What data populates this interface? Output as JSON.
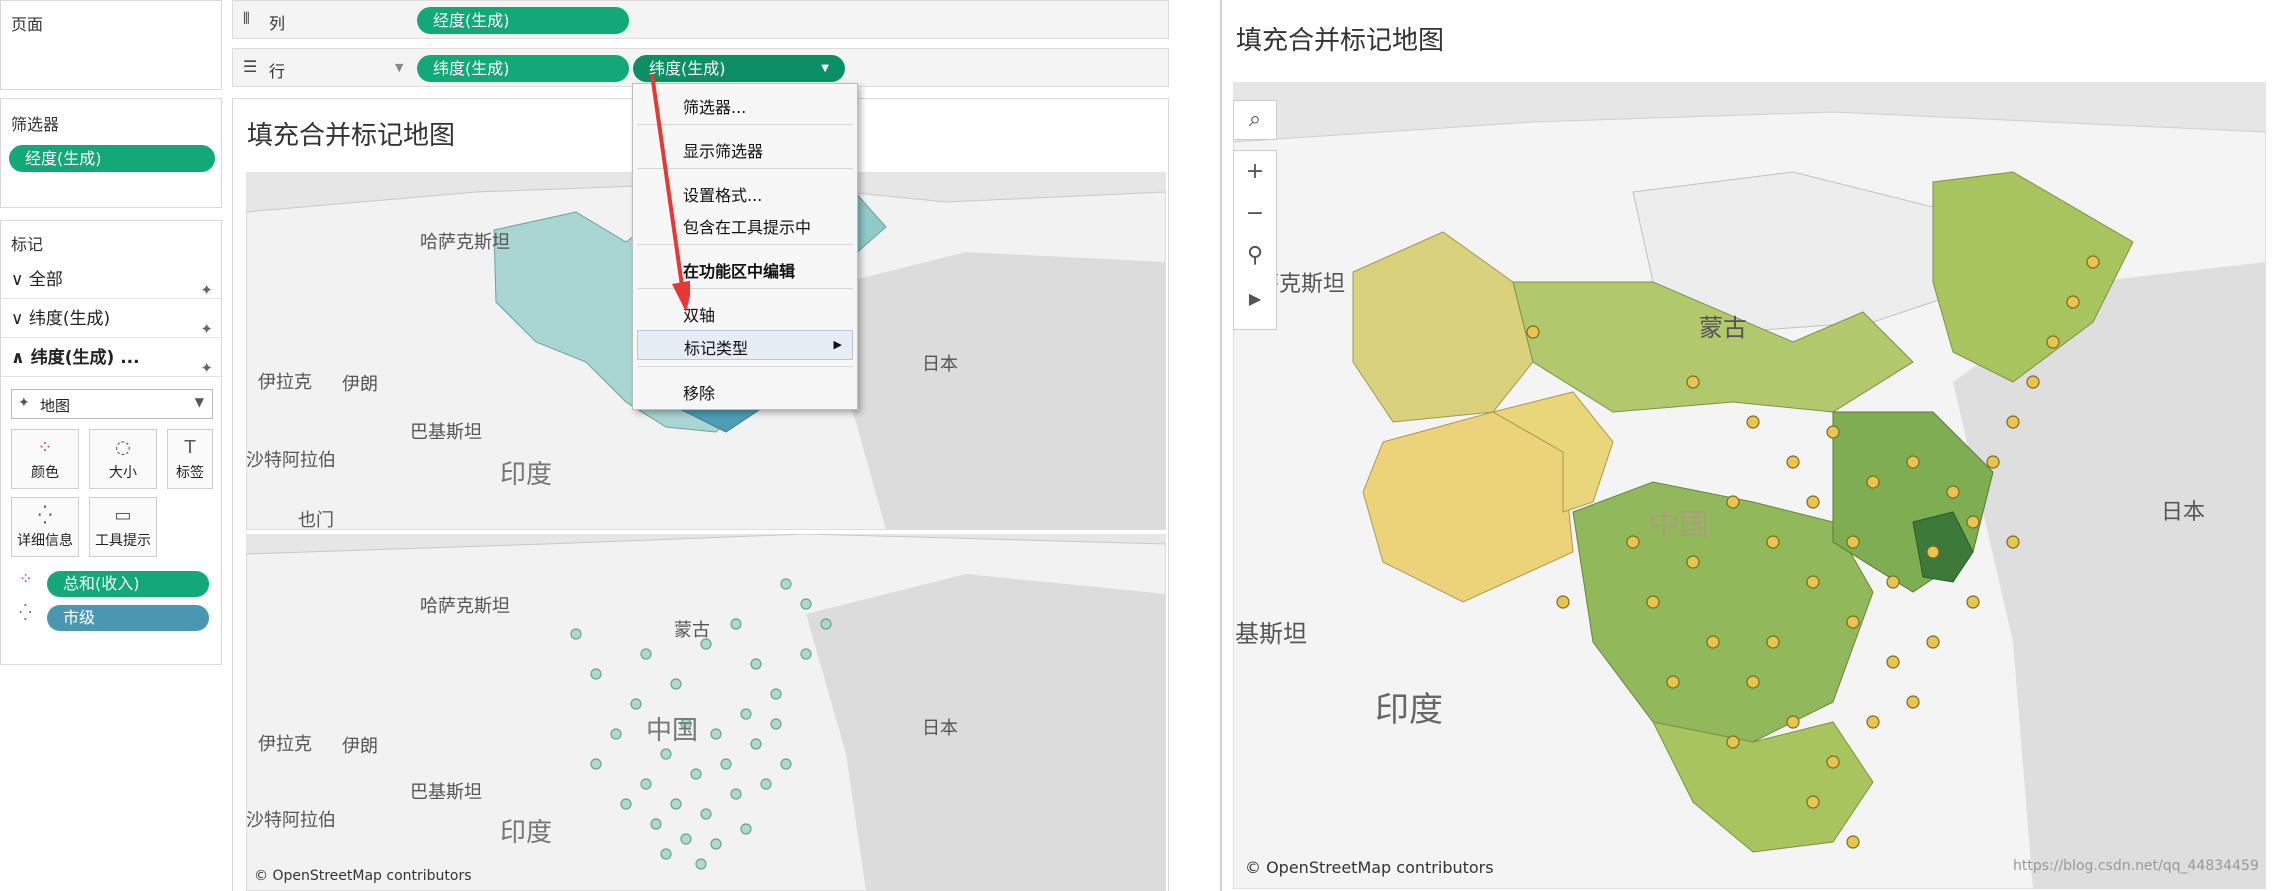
{
  "left_panel": {
    "pages_label": "页面",
    "filters_label": "筛选器",
    "filter_pill": "经度(生成)",
    "marks_label": "标记",
    "marks_items": [
      "全部",
      "纬度(生成)",
      "纬度(生成) ..."
    ],
    "mark_type": "地图",
    "tiles": [
      "颜色",
      "大小",
      "标签",
      "详细信息",
      "工具提示"
    ],
    "mark_fields": [
      "总和(收入)",
      "市级"
    ]
  },
  "shelves": {
    "columns_label": "列",
    "columns_pill": "经度(生成)",
    "rows_label": "行",
    "rows_pills": [
      "纬度(生成)",
      "纬度(生成)"
    ]
  },
  "context_menu": {
    "items": [
      "筛选器...",
      "显示筛选器",
      "设置格式...",
      "包含在工具提示中",
      "在功能区中编辑",
      "双轴",
      "标记类型",
      "移除"
    ]
  },
  "worksheet": {
    "title": "填充合并标记地图",
    "map_labels_top": [
      "哈萨克斯坦",
      "伊拉克",
      "伊朗",
      "巴基斯坦",
      "沙特阿拉伯",
      "印度",
      "也门",
      "日本"
    ],
    "map_labels_bottom": [
      "哈萨克斯坦",
      "蒙古",
      "中国",
      "伊拉克",
      "伊朗",
      "巴基斯坦",
      "沙特阿拉伯",
      "印度",
      "日本"
    ],
    "copyright": "© OpenStreetMap contributors"
  },
  "result_view": {
    "title": "填充合并标记地图",
    "map_labels": [
      "哈萨克斯坦",
      "蒙古",
      "中国",
      "日本",
      "基斯坦",
      "印度"
    ],
    "copyright": "© OpenStreetMap contributors",
    "watermark": "https://blog.csdn.net/qq_44834459"
  },
  "colors": {
    "accent_green": "#12a878",
    "accent_blue": "#4a97b2",
    "arrow_red": "#e53935"
  }
}
